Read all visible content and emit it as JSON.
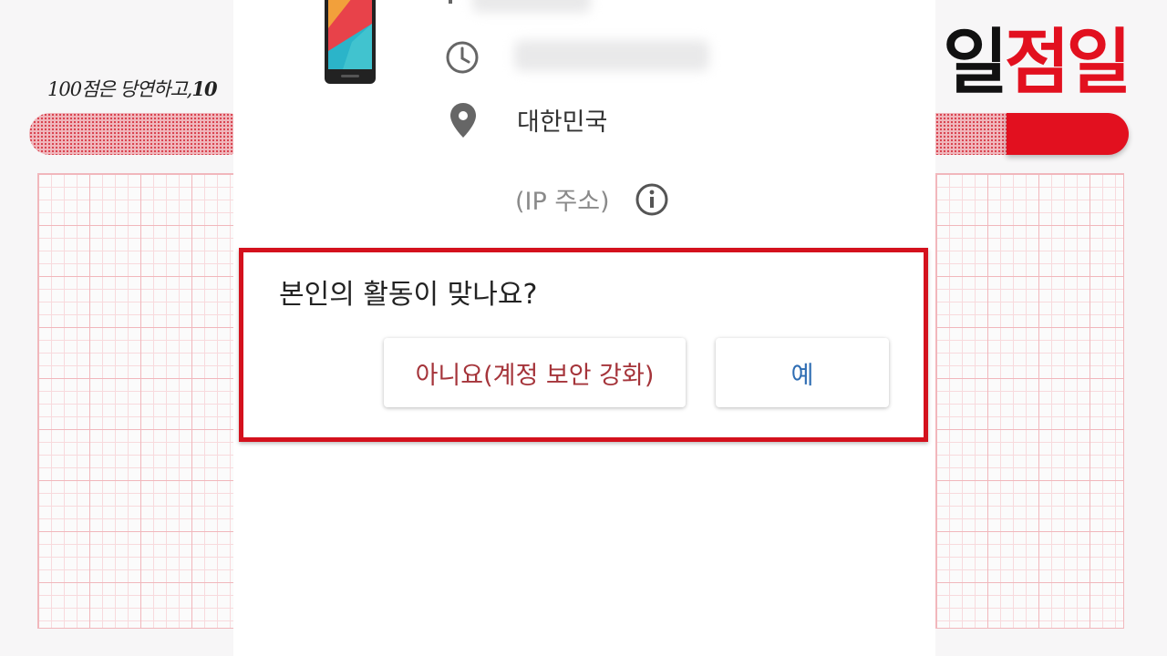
{
  "background": {
    "slogan": "100점은 당연하고,",
    "slogan_tail": "10",
    "brand": {
      "part1": "일",
      "part2": "점",
      "part3": "일"
    },
    "colors": {
      "brand_red": "#e2101f",
      "grid_line": "#f1b7bc"
    }
  },
  "activity": {
    "device_icon": "smartphone-icon",
    "time_icon": "clock-icon",
    "location_icon": "map-pin-icon",
    "location": "대한민국",
    "ip_label": "(IP 주소)",
    "info_icon": "info-icon"
  },
  "dialog": {
    "question": "본인의 활동이 맞나요?",
    "no_button": "아니요(계정 보안 강화)",
    "yes_button": "예",
    "colors": {
      "no": "#a5343a",
      "yes": "#2e6db3",
      "highlight_border": "#d4111d"
    }
  }
}
